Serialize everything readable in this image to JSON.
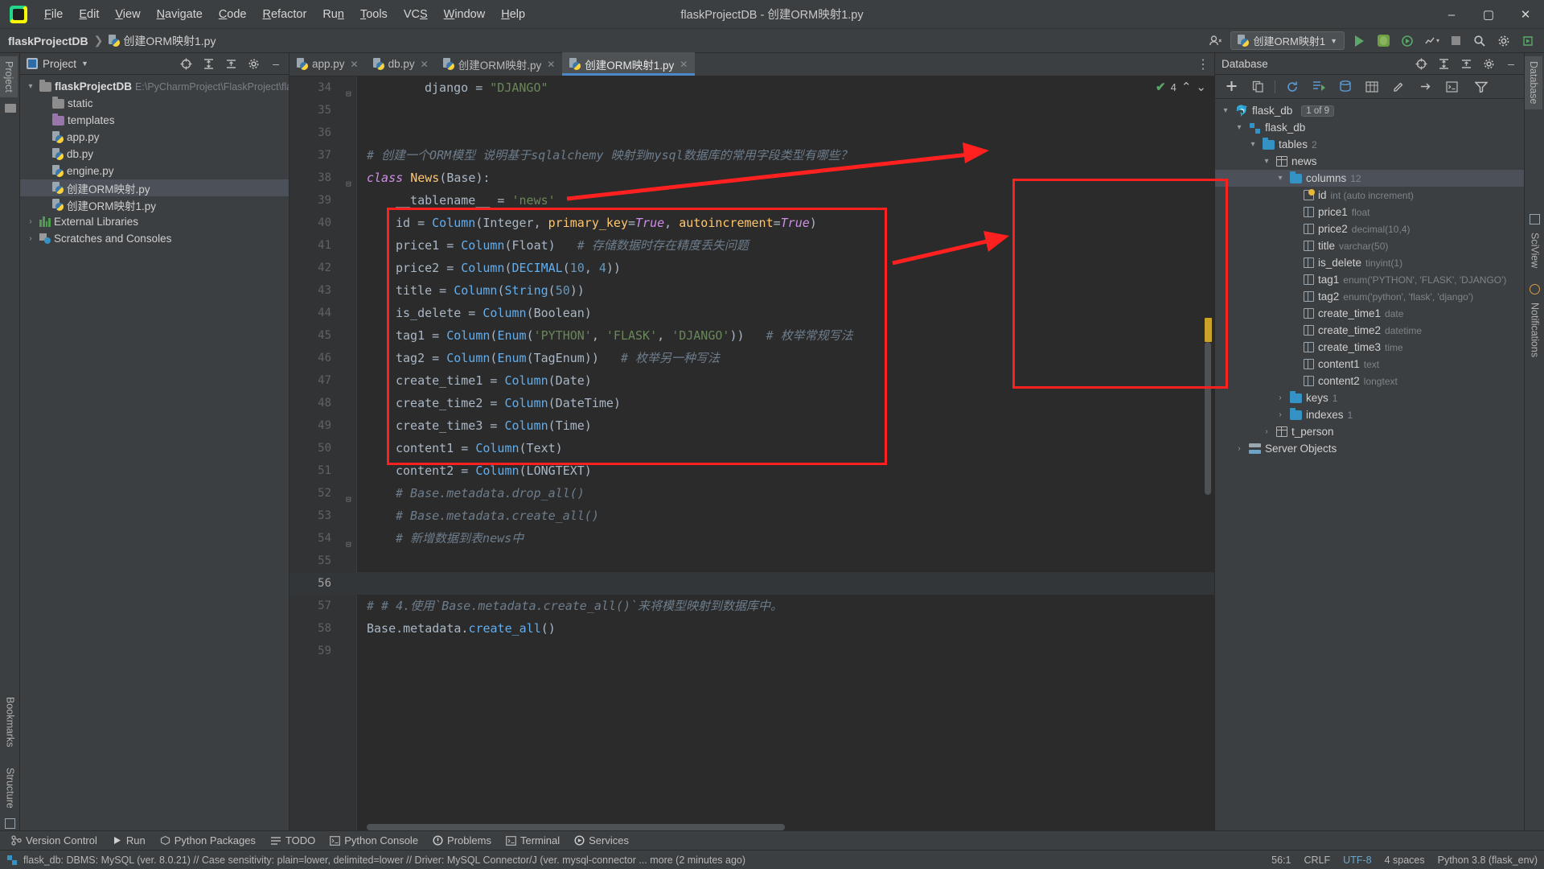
{
  "window": {
    "title": "flaskProjectDB - 创建ORM映射1.py",
    "minimize": "–",
    "maximize": "▢",
    "close": "✕"
  },
  "menubar": {
    "items": [
      "File",
      "Edit",
      "View",
      "Navigate",
      "Code",
      "Refactor",
      "Run",
      "Tools",
      "VCS",
      "Window",
      "Help"
    ]
  },
  "navbar": {
    "project_name": "flaskProjectDB",
    "separator": "❯",
    "current_file": "创建ORM映射1.py",
    "run_config": "创建ORM映射1",
    "icons": [
      "user-icon",
      "run-icon",
      "debug-icon",
      "coverage-icon",
      "profile-icon",
      "stop-icon",
      "search-icon",
      "settings-icon",
      "updates-icon"
    ]
  },
  "left_strips": {
    "top": [
      "Project"
    ],
    "bottom": [
      "Bookmarks",
      "Structure"
    ]
  },
  "right_strips": {
    "top": [
      "Database"
    ],
    "bottom": [
      "SciView",
      "Notifications"
    ]
  },
  "project_panel": {
    "title": "Project",
    "tree": [
      {
        "label": "flaskProjectDB",
        "meta": "E:\\PyCharmProject\\FlaskProject\\flasl",
        "icon": "folder-icon",
        "indent": 0,
        "arrow": "▾",
        "bold": true,
        "selected": false
      },
      {
        "label": "static",
        "meta": "",
        "icon": "folder-icon",
        "indent": 1,
        "arrow": "",
        "bold": false,
        "selected": false
      },
      {
        "label": "templates",
        "meta": "",
        "icon": "folder-purple-icon",
        "indent": 1,
        "arrow": "",
        "bold": false,
        "selected": false
      },
      {
        "label": "app.py",
        "meta": "",
        "icon": "python-file-icon",
        "indent": 1,
        "arrow": "",
        "bold": false,
        "selected": false
      },
      {
        "label": "db.py",
        "meta": "",
        "icon": "python-file-icon",
        "indent": 1,
        "arrow": "",
        "bold": false,
        "selected": false
      },
      {
        "label": "engine.py",
        "meta": "",
        "icon": "python-file-icon",
        "indent": 1,
        "arrow": "",
        "bold": false,
        "selected": false
      },
      {
        "label": "创建ORM映射.py",
        "meta": "",
        "icon": "python-file-icon",
        "indent": 1,
        "arrow": "",
        "bold": false,
        "selected": true
      },
      {
        "label": "创建ORM映射1.py",
        "meta": "",
        "icon": "python-file-icon",
        "indent": 1,
        "arrow": "",
        "bold": false,
        "selected": false
      },
      {
        "label": "External Libraries",
        "meta": "",
        "icon": "library-icon",
        "indent": 0,
        "arrow": "›",
        "bold": false,
        "selected": false
      },
      {
        "label": "Scratches and Consoles",
        "meta": "",
        "icon": "scratches-icon",
        "indent": 0,
        "arrow": "›",
        "bold": false,
        "selected": false
      }
    ]
  },
  "editor": {
    "tabs": [
      {
        "label": "app.py",
        "active": false
      },
      {
        "label": "db.py",
        "active": false
      },
      {
        "label": "创建ORM映射.py",
        "active": false
      },
      {
        "label": "创建ORM映射1.py",
        "active": true
      }
    ],
    "inspection_count": "4",
    "lines": [
      {
        "n": "34",
        "indent": 8,
        "fold": "⊟",
        "segments": [
          {
            "t": "django ",
            "c": "plain"
          },
          {
            "t": "= ",
            "c": "plain"
          },
          {
            "t": "\"DJANGO\"",
            "c": "str"
          }
        ]
      },
      {
        "n": "35",
        "indent": 0,
        "fold": "",
        "segments": []
      },
      {
        "n": "36",
        "indent": 0,
        "fold": "",
        "segments": []
      },
      {
        "n": "37",
        "indent": 0,
        "fold": "",
        "segments": [
          {
            "t": "# 创建一个ORM模型 说明基于sqlalchemy 映射到mysql数据库的常用字段类型有哪些？",
            "c": "cmt"
          }
        ]
      },
      {
        "n": "38",
        "indent": 0,
        "fold": "⊟",
        "segments": [
          {
            "t": "class ",
            "c": "kw2"
          },
          {
            "t": "News",
            "c": "cls"
          },
          {
            "t": "(Base):",
            "c": "plain"
          }
        ]
      },
      {
        "n": "39",
        "indent": 4,
        "fold": "",
        "segments": [
          {
            "t": "__tablename__",
            "c": "plain squig"
          },
          {
            "t": " = ",
            "c": "plain"
          },
          {
            "t": "'news'",
            "c": "str"
          }
        ]
      },
      {
        "n": "40",
        "indent": 4,
        "fold": "",
        "segments": [
          {
            "t": "id = ",
            "c": "plain"
          },
          {
            "t": "Column",
            "c": "fn"
          },
          {
            "t": "(Integer, ",
            "c": "plain"
          },
          {
            "t": "primary_key",
            "c": "cls"
          },
          {
            "t": "=",
            "c": "plain"
          },
          {
            "t": "True",
            "c": "kw2"
          },
          {
            "t": ", ",
            "c": "plain"
          },
          {
            "t": "autoincrement",
            "c": "cls"
          },
          {
            "t": "=",
            "c": "plain"
          },
          {
            "t": "True",
            "c": "kw2"
          },
          {
            "t": ")",
            "c": "plain"
          }
        ]
      },
      {
        "n": "41",
        "indent": 4,
        "fold": "",
        "segments": [
          {
            "t": "price1 = ",
            "c": "plain"
          },
          {
            "t": "Column",
            "c": "fn"
          },
          {
            "t": "(Float)   ",
            "c": "plain"
          },
          {
            "t": "# 存储数据时存在精度丢失问题",
            "c": "cmt"
          }
        ]
      },
      {
        "n": "42",
        "indent": 4,
        "fold": "",
        "segments": [
          {
            "t": "price2 = ",
            "c": "plain"
          },
          {
            "t": "Column",
            "c": "fn"
          },
          {
            "t": "(",
            "c": "plain"
          },
          {
            "t": "DECIMAL",
            "c": "fn"
          },
          {
            "t": "(",
            "c": "plain"
          },
          {
            "t": "10",
            "c": "num"
          },
          {
            "t": ", ",
            "c": "plain"
          },
          {
            "t": "4",
            "c": "num"
          },
          {
            "t": "))",
            "c": "plain"
          }
        ]
      },
      {
        "n": "43",
        "indent": 4,
        "fold": "",
        "segments": [
          {
            "t": "title = ",
            "c": "plain"
          },
          {
            "t": "Column",
            "c": "fn"
          },
          {
            "t": "(",
            "c": "plain"
          },
          {
            "t": "String",
            "c": "fn"
          },
          {
            "t": "(",
            "c": "plain"
          },
          {
            "t": "50",
            "c": "num"
          },
          {
            "t": "))",
            "c": "plain"
          }
        ]
      },
      {
        "n": "44",
        "indent": 4,
        "fold": "",
        "segments": [
          {
            "t": "is_delete = ",
            "c": "plain"
          },
          {
            "t": "Column",
            "c": "fn"
          },
          {
            "t": "(Boolean)",
            "c": "plain"
          }
        ]
      },
      {
        "n": "45",
        "indent": 4,
        "fold": "",
        "segments": [
          {
            "t": "tag1 = ",
            "c": "plain"
          },
          {
            "t": "Column",
            "c": "fn"
          },
          {
            "t": "(",
            "c": "plain"
          },
          {
            "t": "Enum",
            "c": "fn"
          },
          {
            "t": "(",
            "c": "plain"
          },
          {
            "t": "'PYTHON'",
            "c": "str"
          },
          {
            "t": ", ",
            "c": "plain"
          },
          {
            "t": "'FLASK'",
            "c": "str"
          },
          {
            "t": ", ",
            "c": "plain"
          },
          {
            "t": "'DJANGO'",
            "c": "str"
          },
          {
            "t": "))   ",
            "c": "plain"
          },
          {
            "t": "# 枚举常规写法",
            "c": "cmt"
          }
        ]
      },
      {
        "n": "46",
        "indent": 4,
        "fold": "",
        "segments": [
          {
            "t": "tag2 = ",
            "c": "plain"
          },
          {
            "t": "Column",
            "c": "fn"
          },
          {
            "t": "(",
            "c": "plain"
          },
          {
            "t": "Enum",
            "c": "fn"
          },
          {
            "t": "(TagEnum))   ",
            "c": "plain"
          },
          {
            "t": "# 枚举另一种写法",
            "c": "cmt"
          }
        ]
      },
      {
        "n": "47",
        "indent": 4,
        "fold": "",
        "segments": [
          {
            "t": "create_time1 = ",
            "c": "plain"
          },
          {
            "t": "Column",
            "c": "fn"
          },
          {
            "t": "(Date)",
            "c": "plain"
          }
        ]
      },
      {
        "n": "48",
        "indent": 4,
        "fold": "",
        "segments": [
          {
            "t": "create_time2 = ",
            "c": "plain"
          },
          {
            "t": "Column",
            "c": "fn"
          },
          {
            "t": "(DateTime)",
            "c": "plain"
          }
        ]
      },
      {
        "n": "49",
        "indent": 4,
        "fold": "",
        "segments": [
          {
            "t": "create_time3 = ",
            "c": "plain"
          },
          {
            "t": "Column",
            "c": "fn"
          },
          {
            "t": "(Time)",
            "c": "plain"
          }
        ]
      },
      {
        "n": "50",
        "indent": 4,
        "fold": "",
        "segments": [
          {
            "t": "content1 = ",
            "c": "plain"
          },
          {
            "t": "Column",
            "c": "fn"
          },
          {
            "t": "(Text)",
            "c": "plain"
          }
        ]
      },
      {
        "n": "51",
        "indent": 4,
        "fold": "",
        "segments": [
          {
            "t": "content2 = ",
            "c": "plain"
          },
          {
            "t": "Column",
            "c": "fn"
          },
          {
            "t": "(LONGTEXT)",
            "c": "plain"
          }
        ]
      },
      {
        "n": "52",
        "indent": 4,
        "fold": "⊟",
        "segments": [
          {
            "t": "# Base.metadata.drop_all()",
            "c": "cmt"
          }
        ]
      },
      {
        "n": "53",
        "indent": 4,
        "fold": "",
        "segments": [
          {
            "t": "# Base.metadata.create_all()",
            "c": "cmt"
          }
        ]
      },
      {
        "n": "54",
        "indent": 4,
        "fold": "⊟",
        "segments": [
          {
            "t": "# 新增数据到表news中",
            "c": "cmt"
          }
        ]
      },
      {
        "n": "55",
        "indent": 0,
        "fold": "",
        "segments": []
      },
      {
        "n": "56",
        "indent": 0,
        "fold": "",
        "segments": [],
        "current": true
      },
      {
        "n": "57",
        "indent": 0,
        "fold": "",
        "segments": [
          {
            "t": "# # 4.使用`Base.metadata.create_all()`来将模型映射到数据库中。",
            "c": "cmt"
          }
        ]
      },
      {
        "n": "58",
        "indent": 0,
        "fold": "",
        "segments": [
          {
            "t": "Base.metadata.",
            "c": "plain"
          },
          {
            "t": "create_all",
            "c": "fn"
          },
          {
            "t": "()",
            "c": "plain"
          }
        ]
      },
      {
        "n": "59",
        "indent": 0,
        "fold": "",
        "segments": []
      }
    ]
  },
  "database_panel": {
    "title": "Database",
    "toolbar_icons": [
      "add-icon",
      "copy-icon",
      "refresh-icon",
      "run-query-icon",
      "data-source-icon",
      "table-icon",
      "edit-icon",
      "expand-icon",
      "console-icon",
      "filter-icon"
    ],
    "tree": [
      {
        "label": "flask_db",
        "meta": "",
        "badge": "1 of 9",
        "icon": "mysql-icon",
        "indent": 0,
        "arrow": "▾",
        "highlighted": false
      },
      {
        "label": "flask_db",
        "meta": "",
        "badge": "",
        "icon": "schema-icon",
        "indent": 1,
        "arrow": "▾",
        "highlighted": false
      },
      {
        "label": "tables",
        "meta": "2",
        "badge": "",
        "icon": "folder-blue-icon",
        "indent": 2,
        "arrow": "▾",
        "highlighted": false
      },
      {
        "label": "news",
        "meta": "",
        "badge": "",
        "icon": "table-icon",
        "indent": 3,
        "arrow": "▾",
        "highlighted": false
      },
      {
        "label": "columns",
        "meta": "12",
        "badge": "",
        "icon": "folder-blue-icon",
        "indent": 4,
        "arrow": "▾",
        "highlighted": true
      },
      {
        "label": "id",
        "meta": "int (auto increment)",
        "badge": "",
        "icon": "primary-key-icon",
        "indent": 5,
        "arrow": "",
        "highlighted": false
      },
      {
        "label": "price1",
        "meta": "float",
        "badge": "",
        "icon": "column-icon",
        "indent": 5,
        "arrow": "",
        "highlighted": false
      },
      {
        "label": "price2",
        "meta": "decimal(10,4)",
        "badge": "",
        "icon": "column-icon",
        "indent": 5,
        "arrow": "",
        "highlighted": false
      },
      {
        "label": "title",
        "meta": "varchar(50)",
        "badge": "",
        "icon": "column-icon",
        "indent": 5,
        "arrow": "",
        "highlighted": false
      },
      {
        "label": "is_delete",
        "meta": "tinyint(1)",
        "badge": "",
        "icon": "column-icon",
        "indent": 5,
        "arrow": "",
        "highlighted": false
      },
      {
        "label": "tag1",
        "meta": "enum('PYTHON', 'FLASK', 'DJANGO')",
        "badge": "",
        "icon": "column-icon",
        "indent": 5,
        "arrow": "",
        "highlighted": false
      },
      {
        "label": "tag2",
        "meta": "enum('python', 'flask', 'django')",
        "badge": "",
        "icon": "column-icon",
        "indent": 5,
        "arrow": "",
        "highlighted": false
      },
      {
        "label": "create_time1",
        "meta": "date",
        "badge": "",
        "icon": "column-icon",
        "indent": 5,
        "arrow": "",
        "highlighted": false
      },
      {
        "label": "create_time2",
        "meta": "datetime",
        "badge": "",
        "icon": "column-icon",
        "indent": 5,
        "arrow": "",
        "highlighted": false
      },
      {
        "label": "create_time3",
        "meta": "time",
        "badge": "",
        "icon": "column-icon",
        "indent": 5,
        "arrow": "",
        "highlighted": false
      },
      {
        "label": "content1",
        "meta": "text",
        "badge": "",
        "icon": "column-icon",
        "indent": 5,
        "arrow": "",
        "highlighted": false
      },
      {
        "label": "content2",
        "meta": "longtext",
        "badge": "",
        "icon": "column-icon",
        "indent": 5,
        "arrow": "",
        "highlighted": false
      },
      {
        "label": "keys",
        "meta": "1",
        "badge": "",
        "icon": "folder-blue-icon",
        "indent": 4,
        "arrow": "›",
        "highlighted": false
      },
      {
        "label": "indexes",
        "meta": "1",
        "badge": "",
        "icon": "folder-blue-icon",
        "indent": 4,
        "arrow": "›",
        "highlighted": false
      },
      {
        "label": "t_person",
        "meta": "",
        "badge": "",
        "icon": "table-icon",
        "indent": 3,
        "arrow": "›",
        "highlighted": false
      },
      {
        "label": "Server Objects",
        "meta": "",
        "badge": "",
        "icon": "server-objects-icon",
        "indent": 1,
        "arrow": "›",
        "highlighted": false
      }
    ]
  },
  "tool_windows": {
    "items": [
      {
        "label": "Version Control",
        "icon": "branch-icon"
      },
      {
        "label": "Run",
        "icon": "run-icon"
      },
      {
        "label": "Python Packages",
        "icon": "package-icon"
      },
      {
        "label": "TODO",
        "icon": "todo-icon"
      },
      {
        "label": "Python Console",
        "icon": "console-icon"
      },
      {
        "label": "Problems",
        "icon": "problems-icon"
      },
      {
        "label": "Terminal",
        "icon": "terminal-icon"
      },
      {
        "label": "Services",
        "icon": "services-icon"
      }
    ]
  },
  "statusbar": {
    "message": "flask_db: DBMS: MySQL (ver. 8.0.21) // Case sensitivity: plain=lower, delimited=lower // Driver: MySQL Connector/J (ver. mysql-connector ... more (2 minutes ago)",
    "caret": "56:1",
    "line_sep": "CRLF",
    "encoding": "UTF-8",
    "indent": "4 spaces",
    "interpreter": "Python 3.8 (flask_env)"
  },
  "colors": {
    "accent": "#4a88c7",
    "annotation_red": "#ff2020",
    "editor_bg": "#2b2b2b",
    "panel_bg": "#3c3f41",
    "string_green": "#6a8759",
    "keyword_orange": "#cc7832"
  }
}
